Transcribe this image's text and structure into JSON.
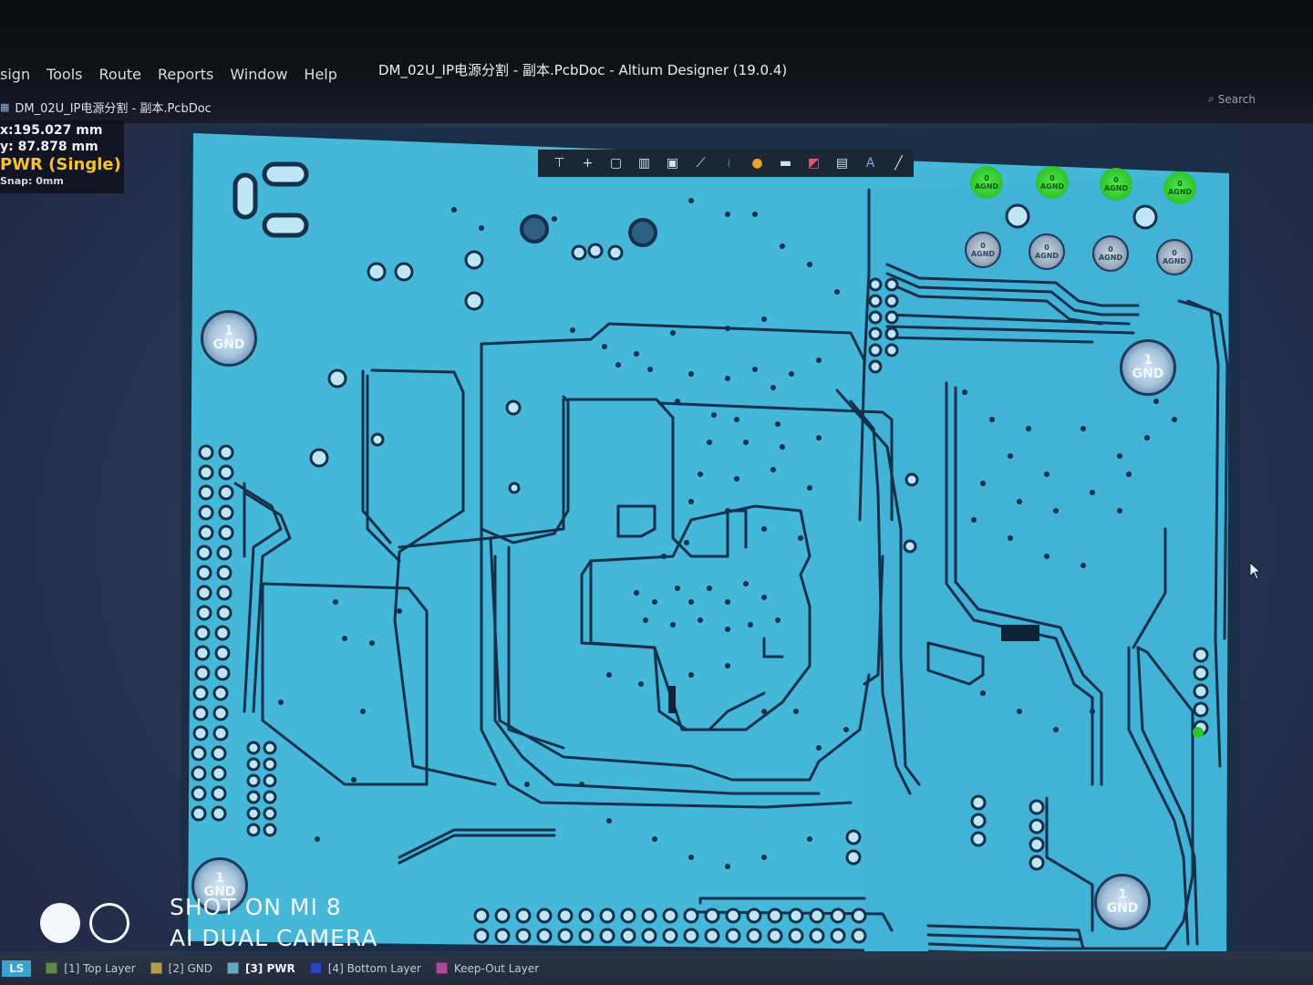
{
  "window": {
    "title": "DM_02U_IP电源分割 - 副本.PcbDoc - Altium Designer (19.0.4)",
    "search_label": "Search"
  },
  "menu": {
    "items": [
      "sign",
      "Tools",
      "Route",
      "Reports",
      "Window",
      "Help"
    ]
  },
  "document_tab": {
    "label": "DM_02U_IP电源分割 - 副本.PcbDoc"
  },
  "hud": {
    "x": "x:195.027 mm",
    "y": "y: 87.878  mm",
    "layer": "PWR (Single)",
    "snap": "Snap: 0mm"
  },
  "toolbar": {
    "icons": [
      "filter-icon",
      "add-icon",
      "select-rect-icon",
      "align-icon",
      "component-icon",
      "route-icon",
      "diff-pair-icon",
      "pin-icon",
      "fill-icon",
      "region-icon",
      "chart-icon",
      "text-icon",
      "line-icon"
    ]
  },
  "net_badges": {
    "agnd_pin": "0",
    "agnd_net": "AGND",
    "gnd_pin": "1",
    "gnd_net": "GND"
  },
  "colors": {
    "plane": "#45b8da",
    "trace": "#14304a",
    "board_bg": "#1a2f47",
    "agnd_green": "#2bc42a",
    "hud_layer": "#f2c230",
    "ls_tab": "#3ba2cf"
  },
  "statusbar": {
    "ls_label": "LS",
    "layers": [
      {
        "label": "[1] Top Layer",
        "color": "#5d8a4a",
        "active": false
      },
      {
        "label": "[2] GND",
        "color": "#b59a52",
        "active": false
      },
      {
        "label": "[3] PWR",
        "color": "#68a8c0",
        "active": true
      },
      {
        "label": "[4] Bottom Layer",
        "color": "#2746c0",
        "active": false
      },
      {
        "label": "Keep-Out Layer",
        "color": "#b0489e",
        "active": false
      }
    ]
  },
  "watermark": {
    "line1": "SHOT ON MI 8",
    "line2": "AI DUAL CAMERA"
  }
}
